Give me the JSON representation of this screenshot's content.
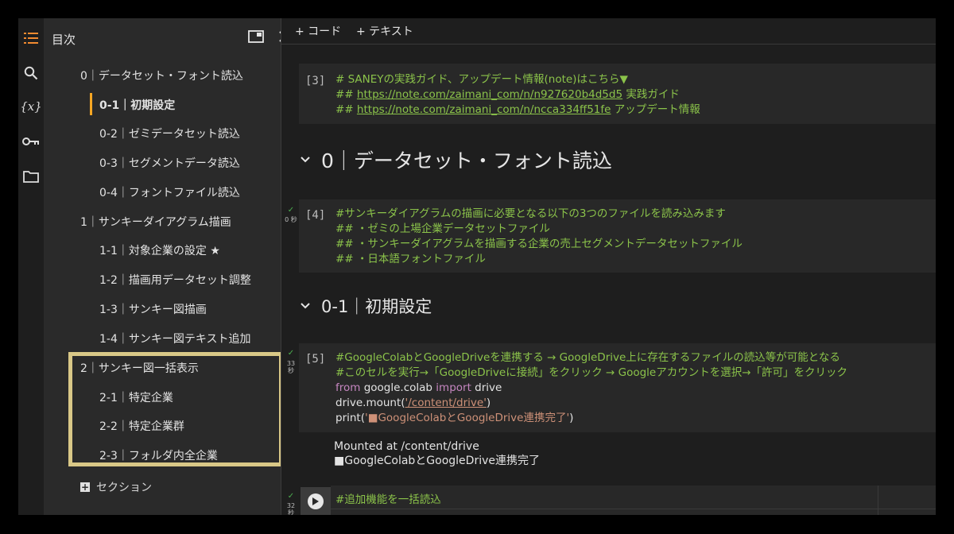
{
  "toc": {
    "title": "目次",
    "items": [
      {
        "label": "0｜データセット・フォント読込"
      },
      {
        "label": "0-1｜初期設定"
      },
      {
        "label": "0-2｜ゼミデータセット読込"
      },
      {
        "label": "0-3｜セグメントデータ読込"
      },
      {
        "label": "0-4｜フォントファイル読込"
      },
      {
        "label": "1｜サンキーダイアグラム描画"
      },
      {
        "label": "1-1｜対象企業の設定 ★"
      },
      {
        "label": "1-2｜描画用データセット調整"
      },
      {
        "label": "1-3｜サンキー図描画"
      },
      {
        "label": "1-4｜サンキー図テキスト追加"
      },
      {
        "label": "2｜サンキー図一括表示"
      },
      {
        "label": "2-1｜特定企業"
      },
      {
        "label": "2-2｜特定企業群"
      },
      {
        "label": "2-3｜フォルダ内全企業"
      }
    ],
    "add_section_label": "セクション"
  },
  "toolbar": {
    "add_code": "+ コード",
    "add_text": "+ テキスト"
  },
  "cells": {
    "c3": {
      "num": "[3]",
      "line1": "# SANEYの実践ガイド、アップデート情報(note)はこちら▼",
      "line2_prefix": "## ",
      "line2_link": "https://note.com/zaimani_com/n/n927620b4d5d5",
      "line2_suffix": " 実践ガイド",
      "line3_prefix": "## ",
      "line3_link": "https://note.com/zaimani_com/n/ncca334ff51fe",
      "line3_suffix": " アップデート情報"
    },
    "heading0": "0｜データセット・フォント読込",
    "c4": {
      "num": "[4]",
      "exec_time": "0 秒",
      "lines": [
        "#サンキーダイアグラムの描画に必要となる以下の3つのファイルを読み込みます",
        "## ・ゼミの上場企業データセットファイル",
        "## ・サンキーダイアグラムを描画する企業の売上セグメントデータセットファイル",
        "## ・日本語フォントファイル"
      ]
    },
    "heading01": "0-1｜初期設定",
    "c5": {
      "num": "[5]",
      "exec_time_a": "33",
      "exec_time_b": "秒",
      "comment1": "#GoogleColabとGoogleDriveを連携する → GoogleDrive上に存在するファイルの読込等が可能となる",
      "comment2": "#このセルを実行→「GoogleDriveに接続」をクリック → Googleアカウントを選択→「許可」をクリック",
      "kw_from": "from",
      "mod": " google.colab ",
      "kw_import": "import",
      "name": " drive",
      "mount_a": "drive.mount(",
      "mount_str": "'/content/drive'",
      "mount_b": ")",
      "print_a": "print(",
      "print_str": "'■GoogleColabとGoogleDrive連携完了'",
      "print_b": ")"
    },
    "out5": {
      "line1": "Mounted at /content/drive",
      "line2": "■GoogleColabとGoogleDrive連携完了"
    },
    "c6": {
      "exec_time_a": "32",
      "exec_time_b": "秒",
      "line1": "#追加機能を一括読込"
    }
  }
}
